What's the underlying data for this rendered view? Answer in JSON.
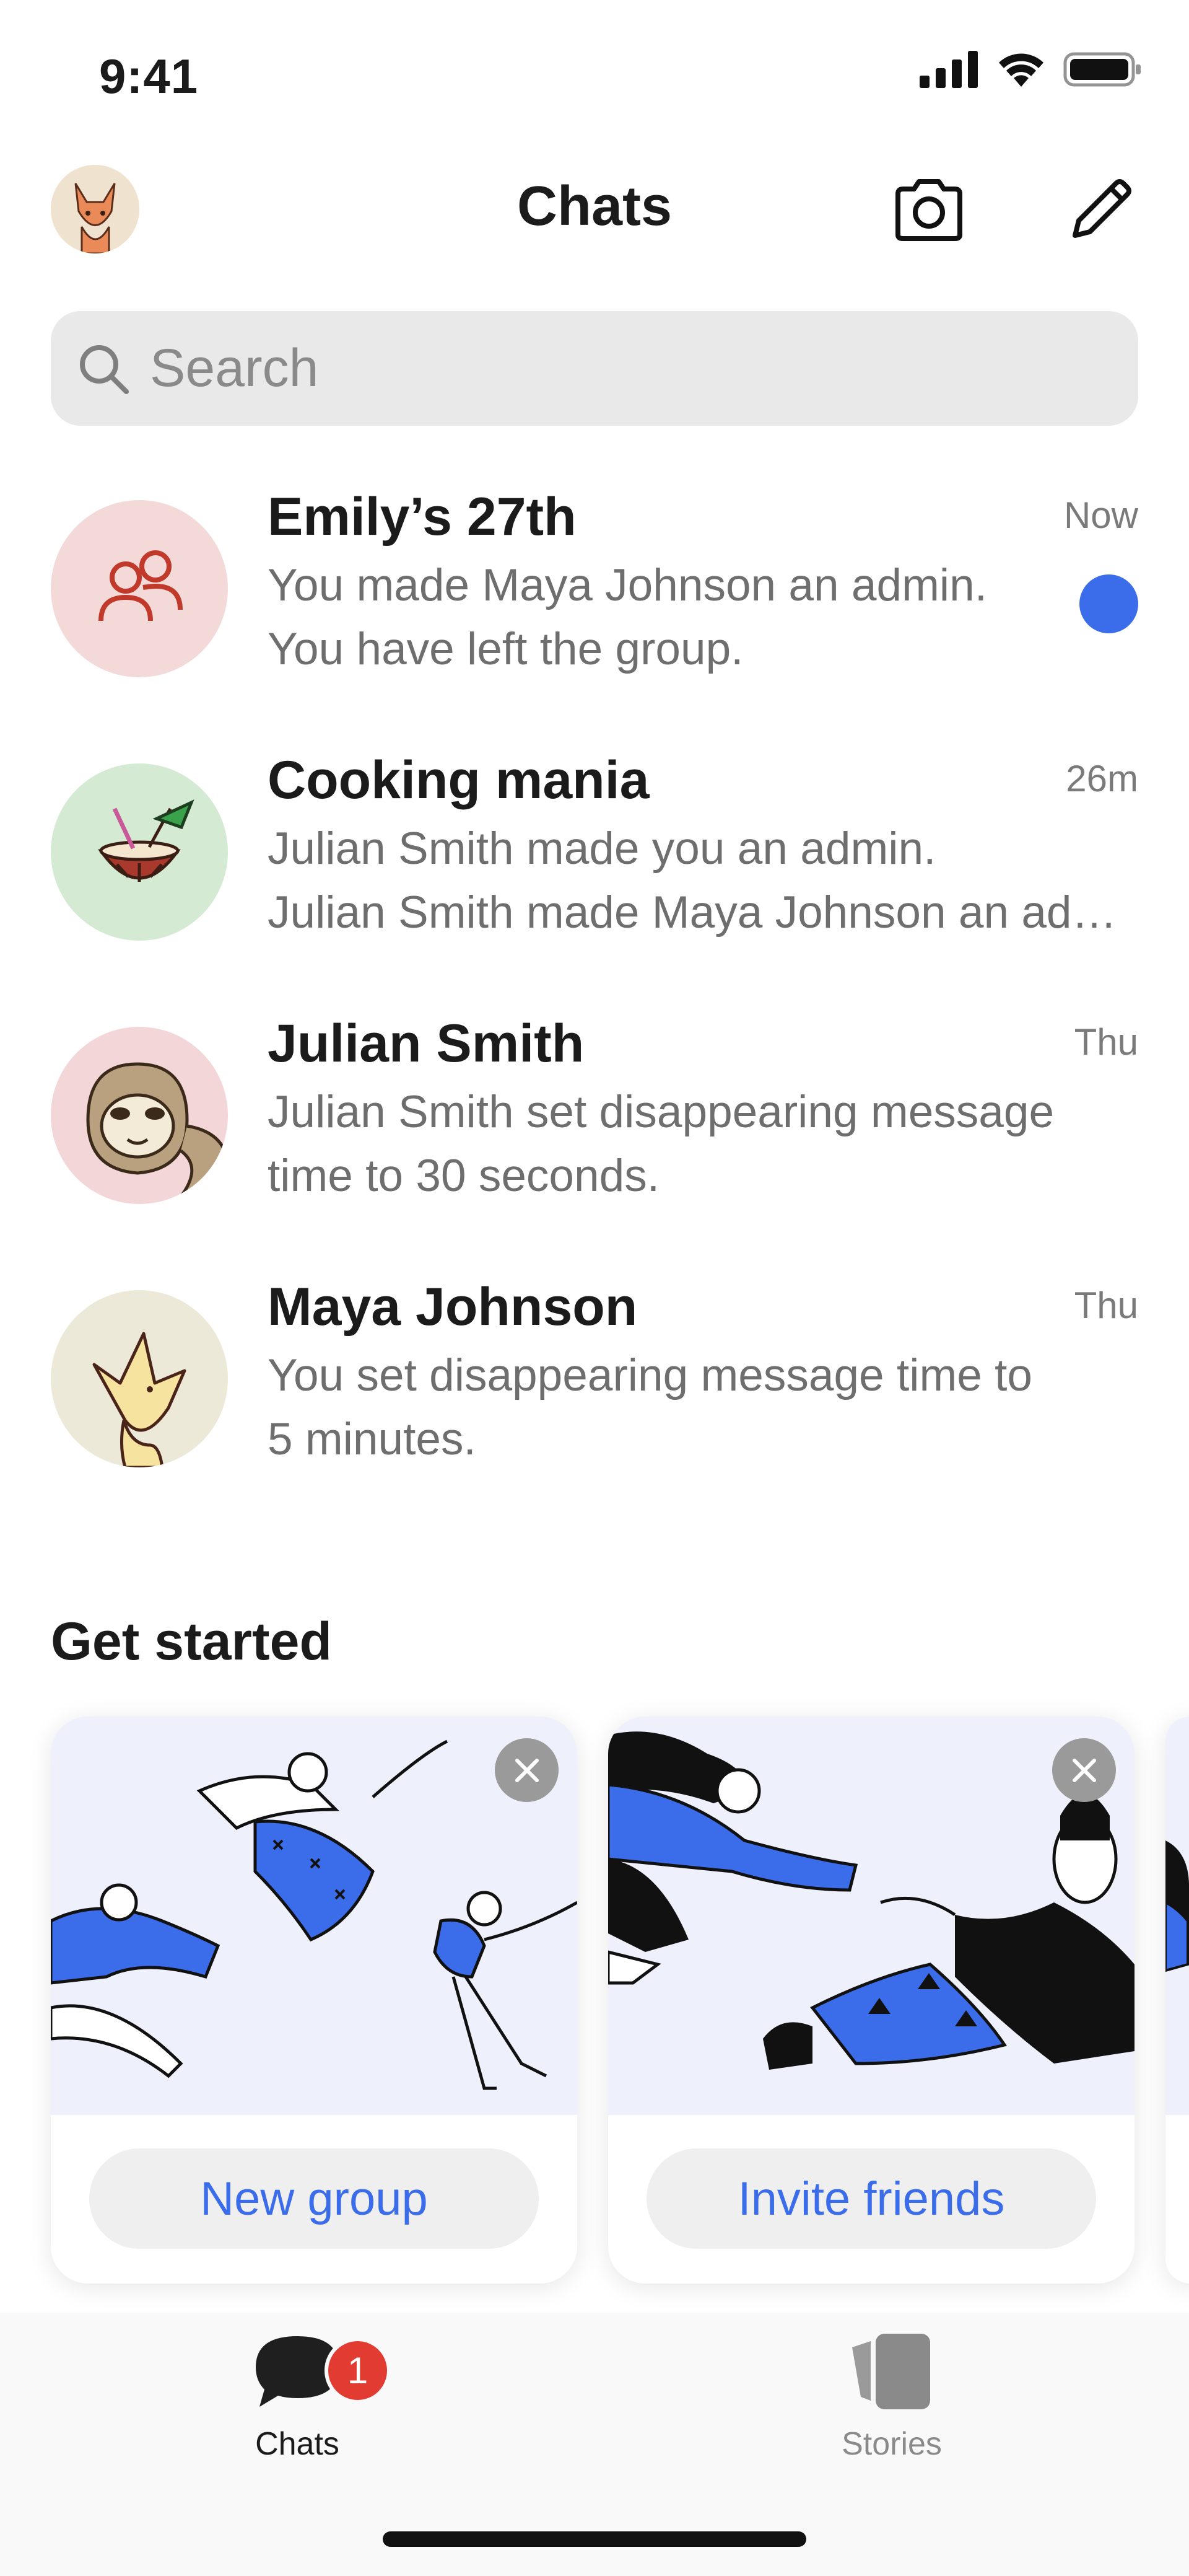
{
  "status_bar": {
    "time": "9:41"
  },
  "header": {
    "title": "Chats"
  },
  "search": {
    "placeholder": "Search",
    "value": ""
  },
  "chats": [
    {
      "name": "Emily’s 27th",
      "time": "Now",
      "lines": [
        "You made Maya Johnson an admin.",
        "You have left the group."
      ],
      "unread": true,
      "avatar_icon": "group-icon",
      "avatar_color": "#f4d9d9"
    },
    {
      "name": "Cooking mania",
      "time": "26m",
      "lines": [
        "Julian Smith made you an admin.",
        "Julian Smith made Maya Johnson an admin."
      ],
      "unread": false,
      "avatar_icon": "coconut-drink-icon",
      "avatar_color": "#d5ead3"
    },
    {
      "name": "Julian Smith",
      "time": "Thu",
      "lines": [
        "Julian  Smith set disappearing message",
        "time to 30 seconds."
      ],
      "unread": false,
      "avatar_icon": "sloth-icon",
      "avatar_color": "#f3d6d8"
    },
    {
      "name": "Maya Johnson",
      "time": "Thu",
      "lines": [
        "You set disappearing message time to",
        "5 minutes."
      ],
      "unread": false,
      "avatar_icon": "fox-icon",
      "avatar_color": "#ece9d8"
    }
  ],
  "get_started": {
    "title": "Get started",
    "cards": [
      {
        "button": "New group",
        "illustration": "dancing-people-illustration"
      },
      {
        "button": "Invite friends",
        "illustration": "friends-reaching-illustration"
      }
    ]
  },
  "tabbar": {
    "tabs": [
      {
        "label": "Chats",
        "badge": "1",
        "icon": "chat-bubble-icon",
        "active": true
      },
      {
        "label": "Stories",
        "icon": "stories-icon",
        "active": false
      }
    ]
  },
  "colors": {
    "accent": "#3b6cea",
    "badge": "#e23c32",
    "search_bg": "#e9e9e9",
    "illustration_bg": "#eef0fb"
  }
}
